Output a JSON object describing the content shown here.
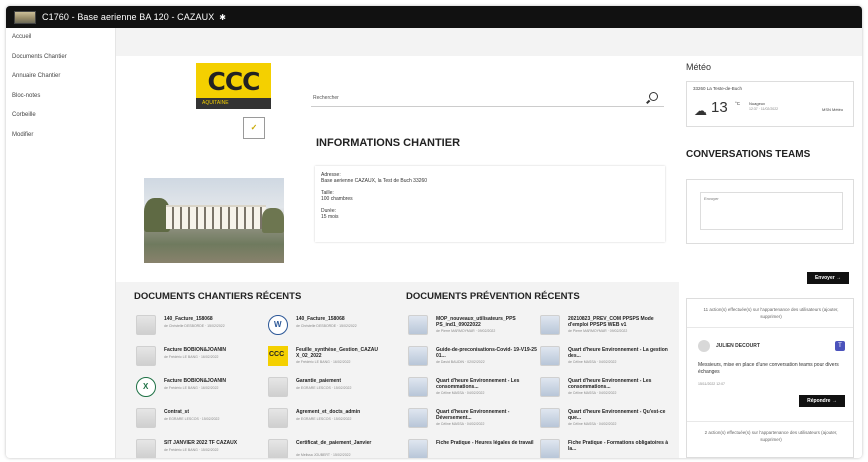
{
  "window": {
    "title": "C1760 - Base aerienne BA 120 - CAZAUX"
  },
  "nav": {
    "items": [
      {
        "label": "Accueil"
      },
      {
        "label": "Documents Chantier"
      },
      {
        "label": "Annuaire Chantier"
      },
      {
        "label": "Bloc-notes"
      },
      {
        "label": "Corbeille"
      },
      {
        "label": "Modifier"
      }
    ]
  },
  "logo": {
    "wordmark": "CCC",
    "subline": "AQUITAINE"
  },
  "search": {
    "placeholder": "Rechercher"
  },
  "info": {
    "title": "INFORMATIONS CHANTIER",
    "address_label": "Adresse:",
    "address": "Base aerienne CAZAUX, la Test de Buch 33260",
    "size_label": "Taille:",
    "size": "100 chambres",
    "duration_label": "Durée:",
    "duration": "15 mois"
  },
  "meteo": {
    "title": "Météo",
    "location": "33260 La Teste-de-Buch",
    "temperature": "13",
    "unit": "°C",
    "condition": "Nuageux",
    "date": "12:37 · 11/02/2022",
    "source": "MSN Météo"
  },
  "teams": {
    "title": "CONVERSATIONS TEAMS",
    "placeholder": "Envoyer",
    "send_label": "Envoyer →",
    "note_top": "11 action(s) effectuée(s) sur l'appartenance des utilisateurs (ajouter, supprimer)",
    "author": "JULIEN DECOURT",
    "message": "Messieurs, mise en place d'une conversation teams pour divers échanges",
    "time": "15/11/2022 12:07",
    "reply_label": "Répondre →",
    "note_bottom": "2 action(s) effectuée(s) sur l'appartenance des utilisateurs (ajouter, supprimer)"
  },
  "docs_recent": {
    "title": "DOCUMENTS CHANTIERS RÉCENTS",
    "items": [
      {
        "name": "140_Facture_158068",
        "meta": "de Christelle DESBORDE · 15/02/2022",
        "icon": "file-icon"
      },
      {
        "name": "140_Facture_158068",
        "meta": "de Christelle DESBORDE · 15/02/2022",
        "icon": "word-icon"
      },
      {
        "name": "Facture BOBION&JOANIN",
        "meta": "de Frédéric LE BANG · 16/02/2022",
        "icon": "file-icon"
      },
      {
        "name": "Feuille_synthèse_Gestion_CAZAU X_02_2022",
        "meta": "de Frédéric LE BANG · 16/02/2022",
        "icon": "ccc-logo-icon"
      },
      {
        "name": "Facture BOBION&JOANIN",
        "meta": "de Frédéric LE BANG · 16/02/2022",
        "icon": "excel-icon"
      },
      {
        "name": "Garantie_paiement",
        "meta": "de EGRARE LESCOS · 15/02/2022",
        "icon": "file-icon"
      },
      {
        "name": "Contrat_st",
        "meta": "de EGRARE LESCOS · 15/02/2022",
        "icon": "file-icon"
      },
      {
        "name": "Agrement_et_docts_admin",
        "meta": "de EGRARE LESCOS · 15/02/2022",
        "icon": "file-icon"
      },
      {
        "name": "SIT JANVIER 2022 TF CAZAUX",
        "meta": "de Frédéric LE BANG · 15/02/2022",
        "icon": "file-icon"
      },
      {
        "name": "Certificat_de_paiement_Janvier",
        "meta": "de Melissa JOUBERT · 15/02/2022",
        "icon": "file-icon"
      }
    ]
  },
  "docs_prevention": {
    "title": "DOCUMENTS PRÉVENTION RÉCENTS",
    "items": [
      {
        "name": "MOP_nouveaux_utilisateurs_PPS PS_ind1_09022022",
        "meta": "de Pierre MARMOYMAR · 09/02/2022",
        "icon": "doc-thumb-icon"
      },
      {
        "name": "20210823_PREV_COM PPSPS Mode d'emploi PPSPS WEB v1",
        "meta": "de Pierre MARMOYMAR · 09/02/2022",
        "icon": "doc-thumb-icon"
      },
      {
        "name": "Guide-de-preconisations-Covid- 19-V19-25 01...",
        "meta": "de David BAUDIN · 02/02/2022",
        "icon": "doc-thumb-icon"
      },
      {
        "name": "Quart d'heure Environnement - La gestion des...",
        "meta": "de Céline MASSA · 04/02/2022",
        "icon": "doc-thumb-icon"
      },
      {
        "name": "Quart d'heure Environnement - Les consommations...",
        "meta": "de Céline MASSA · 04/02/2022",
        "icon": "doc-thumb-icon"
      },
      {
        "name": "Quart d'heure Environnement - Les consommations...",
        "meta": "de Céline MASSA · 04/02/2022",
        "icon": "doc-thumb-icon"
      },
      {
        "name": "Quart d'heure Environnement - Déversement...",
        "meta": "de Céline MASSA · 04/02/2022",
        "icon": "doc-thumb-icon"
      },
      {
        "name": "Quart d'heure Environnement - Qu'est-ce que...",
        "meta": "de Céline MASSA · 04/02/2022",
        "icon": "doc-thumb-icon"
      },
      {
        "name": "Fiche Pratique - Heures légales de travail",
        "meta": "",
        "icon": "doc-thumb-icon"
      },
      {
        "name": "Fiche Pratique - Formations obligatoires à la...",
        "meta": "",
        "icon": "doc-thumb-icon"
      }
    ]
  }
}
